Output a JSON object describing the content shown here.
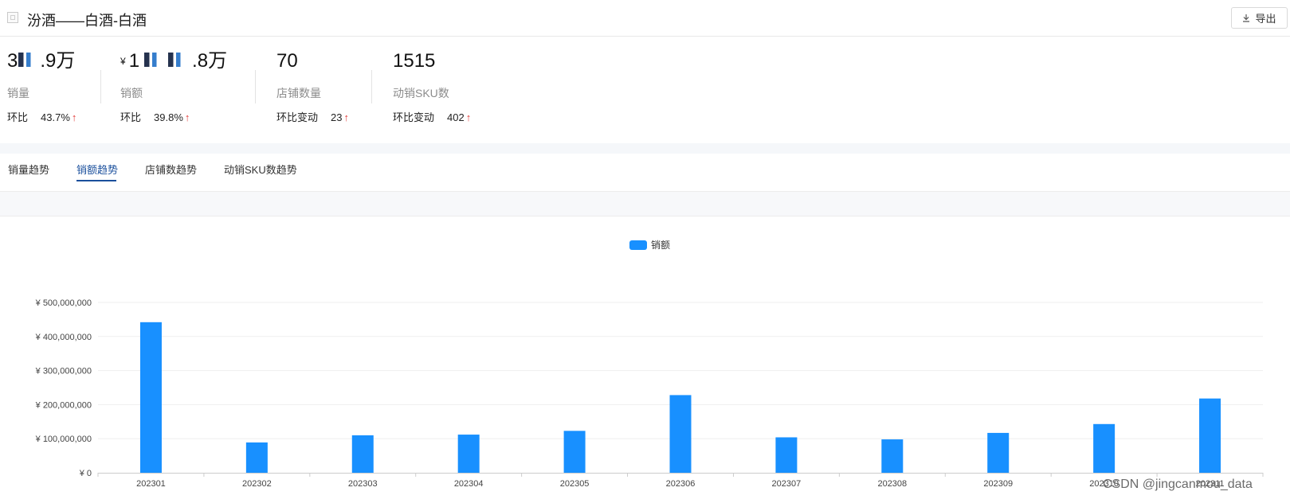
{
  "header": {
    "title": "汾酒——白酒-白酒",
    "export_label": "导出"
  },
  "metrics": [
    {
      "value_prefix": "",
      "value_left": "3",
      "value_right": ".9万",
      "label": "销量",
      "cmp_label": "环比",
      "cmp_value": "43.7%",
      "arrow": "↑"
    },
    {
      "value_prefix": "¥",
      "value_left": "1",
      "value_right": ".8万",
      "label": "销额",
      "cmp_label": "环比",
      "cmp_value": "39.8%",
      "arrow": "↑"
    },
    {
      "value_prefix": "",
      "value_left": "70",
      "value_right": "",
      "label": "店铺数量",
      "cmp_label": "环比变动",
      "cmp_value": "23",
      "arrow": "↑"
    },
    {
      "value_prefix": "",
      "value_left": "1515",
      "value_right": "",
      "label": "动销SKU数",
      "cmp_label": "环比变动",
      "cmp_value": "402",
      "arrow": "↑"
    }
  ],
  "tabs": [
    {
      "label": "销量趋势",
      "active": false
    },
    {
      "label": "销额趋势",
      "active": true
    },
    {
      "label": "店铺数趋势",
      "active": false
    },
    {
      "label": "动销SKU数趋势",
      "active": false
    }
  ],
  "chart_data": {
    "type": "bar",
    "legend": "销额",
    "legend_position": "top-center",
    "categories": [
      "202301",
      "202302",
      "202303",
      "202304",
      "202305",
      "202306",
      "202307",
      "202308",
      "202309",
      "202310",
      "202311"
    ],
    "series": [
      {
        "name": "销额",
        "values": [
          442000000,
          89000000,
          110000000,
          112000000,
          123000000,
          228000000,
          104000000,
          98000000,
          117000000,
          143000000,
          218000000
        ]
      }
    ],
    "ylim": [
      0,
      500000000
    ],
    "yticks": [
      "¥ 0",
      "¥ 100,000,000",
      "¥ 200,000,000",
      "¥ 300,000,000",
      "¥ 400,000,000",
      "¥ 500,000,000"
    ],
    "grid": true,
    "color": "#1890ff"
  },
  "watermark": "CSDN @jingcanmou_data"
}
